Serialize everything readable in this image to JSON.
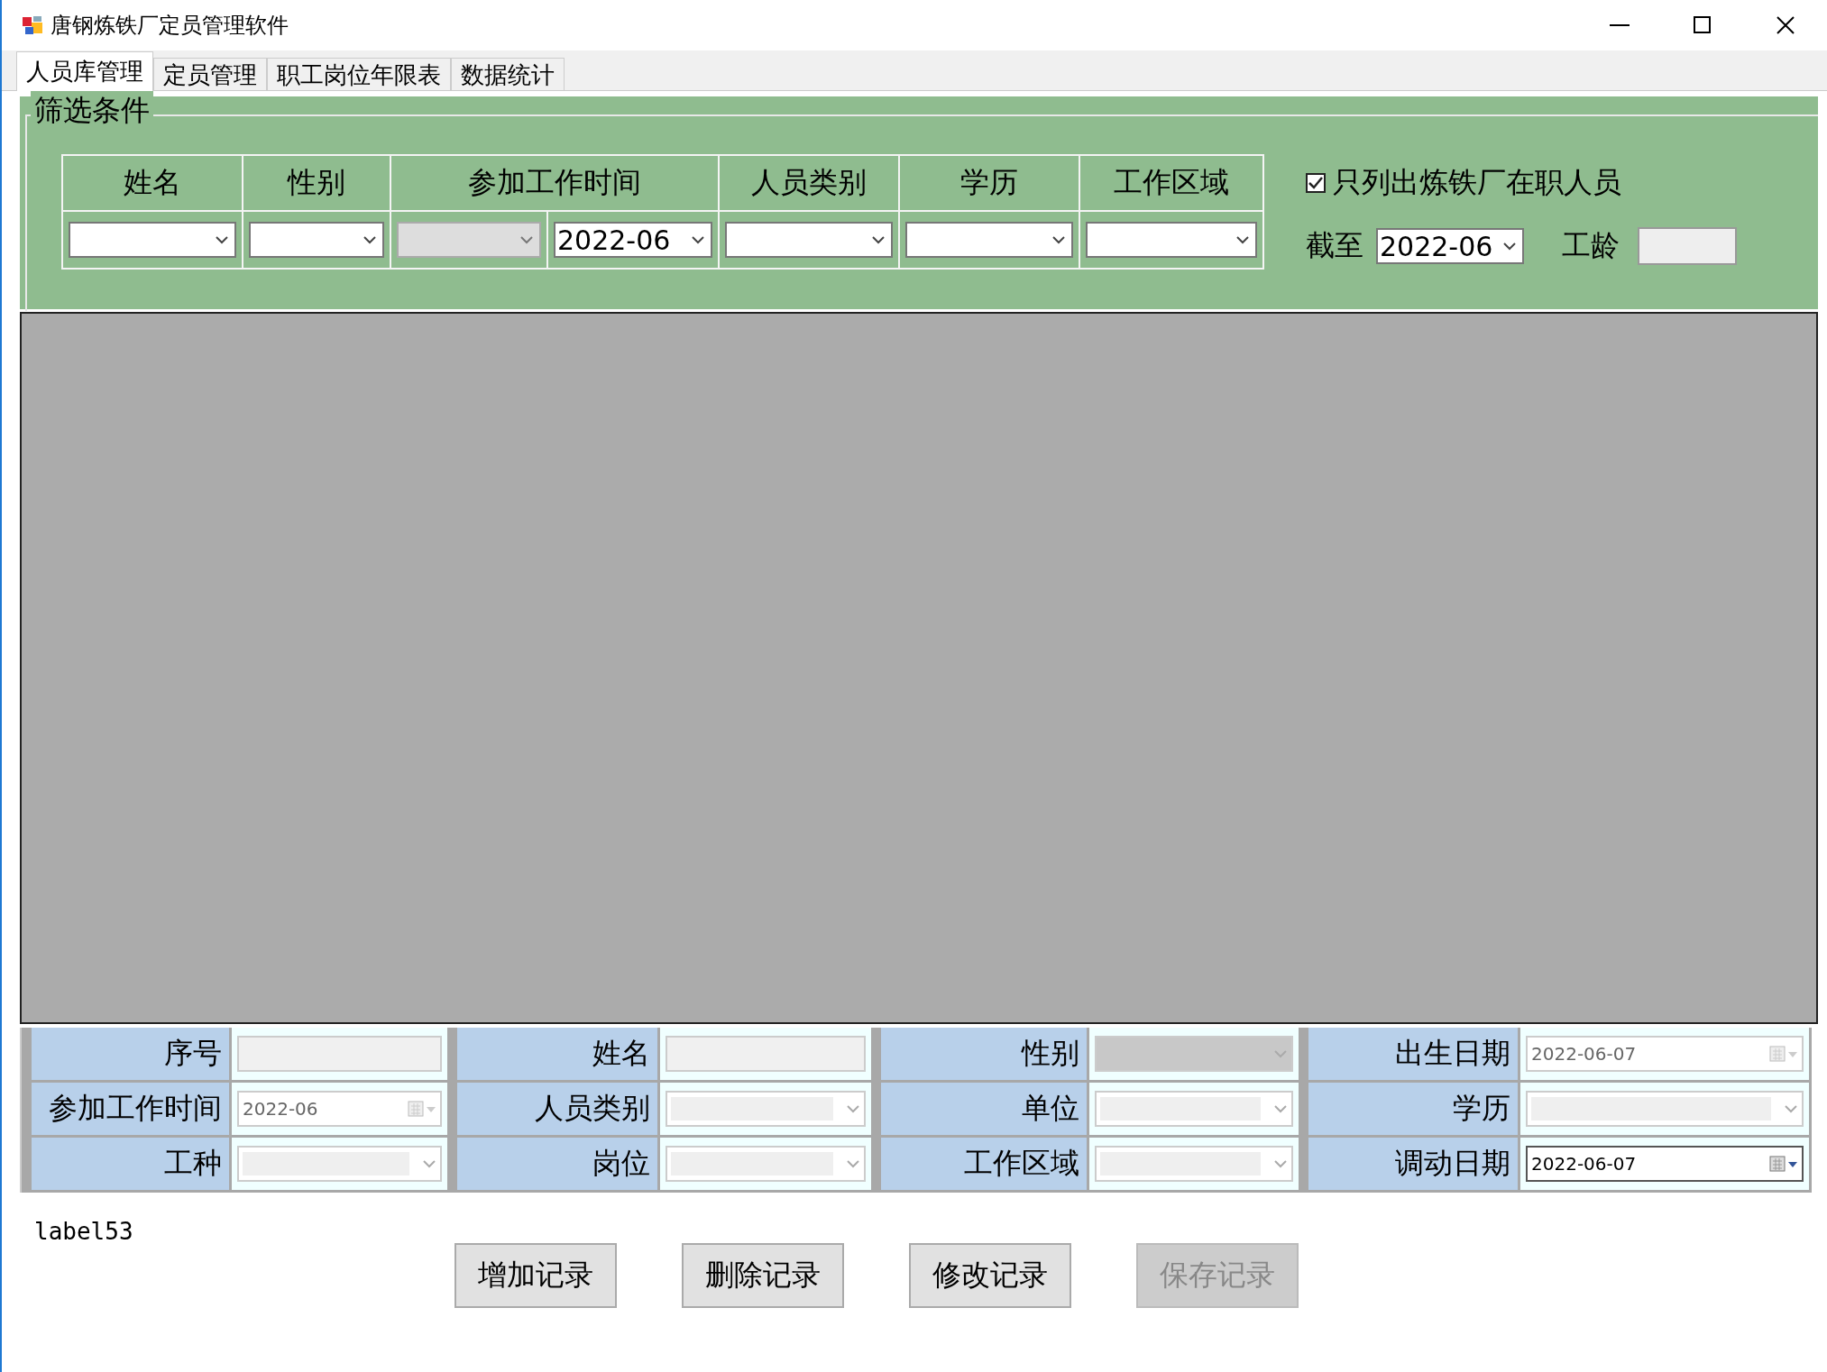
{
  "window": {
    "title": "唐钢炼铁厂定员管理软件"
  },
  "tabs": [
    {
      "label": "人员库管理",
      "selected": true
    },
    {
      "label": "定员管理",
      "selected": false
    },
    {
      "label": "职工岗位年限表",
      "selected": false
    },
    {
      "label": "数据统计",
      "selected": false
    }
  ],
  "filter": {
    "title": "筛选条件",
    "columns": [
      {
        "header": "姓名",
        "fields": [
          {
            "disabled": false
          }
        ]
      },
      {
        "header": "性别",
        "fields": [
          {
            "disabled": false
          }
        ]
      },
      {
        "header": "参加工作时间",
        "fields": [
          {
            "disabled": true
          },
          {
            "value": "2022-06",
            "disabled": false
          }
        ]
      },
      {
        "header": "人员类别",
        "fields": [
          {
            "disabled": false
          }
        ]
      },
      {
        "header": "学历",
        "fields": [
          {
            "disabled": false
          }
        ]
      },
      {
        "header": "工作区域",
        "fields": [
          {
            "disabled": false
          }
        ]
      }
    ],
    "only_active": {
      "label": "只列出炼铁厂在职人员",
      "checked": true
    },
    "as_of": {
      "label": "截至",
      "value": "2022-06"
    },
    "seniority": {
      "label": "工龄",
      "disabled": true
    }
  },
  "form": {
    "rows": [
      [
        {
          "label": "序号",
          "kind": "text",
          "disabled": true
        },
        {
          "label": "姓名",
          "kind": "text",
          "disabled": true
        },
        {
          "label": "性别",
          "kind": "list",
          "disabled": true
        },
        {
          "label": "出生日期",
          "kind": "date",
          "value": "2022-06-07",
          "disabled": true
        }
      ],
      [
        {
          "label": "参加工作时间",
          "kind": "date",
          "value": "2022-06",
          "disabled": true
        },
        {
          "label": "人员类别",
          "kind": "combo",
          "disabled": true
        },
        {
          "label": "单位",
          "kind": "combo",
          "disabled": true
        },
        {
          "label": "学历",
          "kind": "combo",
          "disabled": true
        }
      ],
      [
        {
          "label": "工种",
          "kind": "combo",
          "disabled": true
        },
        {
          "label": "岗位",
          "kind": "combo",
          "disabled": true
        },
        {
          "label": "工作区域",
          "kind": "combo",
          "disabled": true
        },
        {
          "label": "调动日期",
          "kind": "date",
          "value": "2022-06-07",
          "disabled": false
        }
      ]
    ]
  },
  "status_label": "label53",
  "buttons": [
    {
      "label": "增加记录",
      "disabled": false
    },
    {
      "label": "删除记录",
      "disabled": false
    },
    {
      "label": "修改记录",
      "disabled": false
    },
    {
      "label": "保存记录",
      "disabled": true
    }
  ]
}
